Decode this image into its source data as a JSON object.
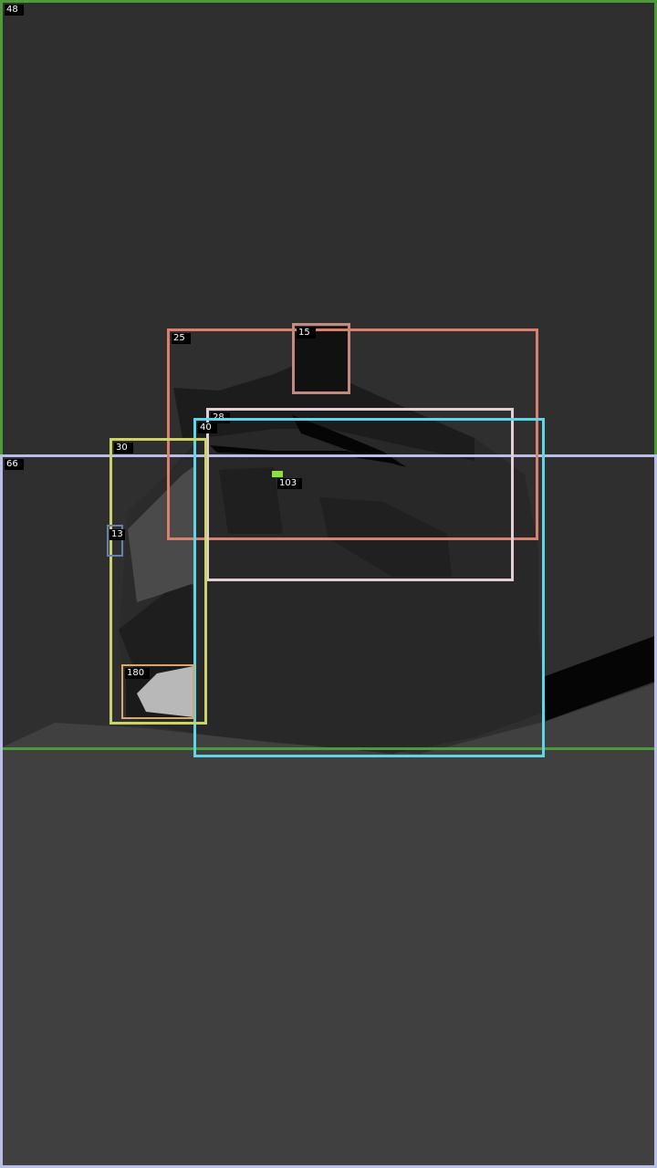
{
  "regions": [
    {
      "id": "48",
      "color": "#4c9a3a"
    },
    {
      "id": "66",
      "color": "#b9bfe6"
    },
    {
      "id": "25",
      "color": "#d9806f"
    },
    {
      "id": "15",
      "color": "#c48a80"
    },
    {
      "id": "28",
      "color": "#e2cfd3"
    },
    {
      "id": "40",
      "color": "#5fd6e8"
    },
    {
      "id": "30",
      "color": "#c9d36a"
    },
    {
      "id": "13",
      "color": "#6a7fb0"
    },
    {
      "id": "180",
      "color": "#d7a86a"
    },
    {
      "id": "103",
      "color": "#8ee03a"
    }
  ]
}
